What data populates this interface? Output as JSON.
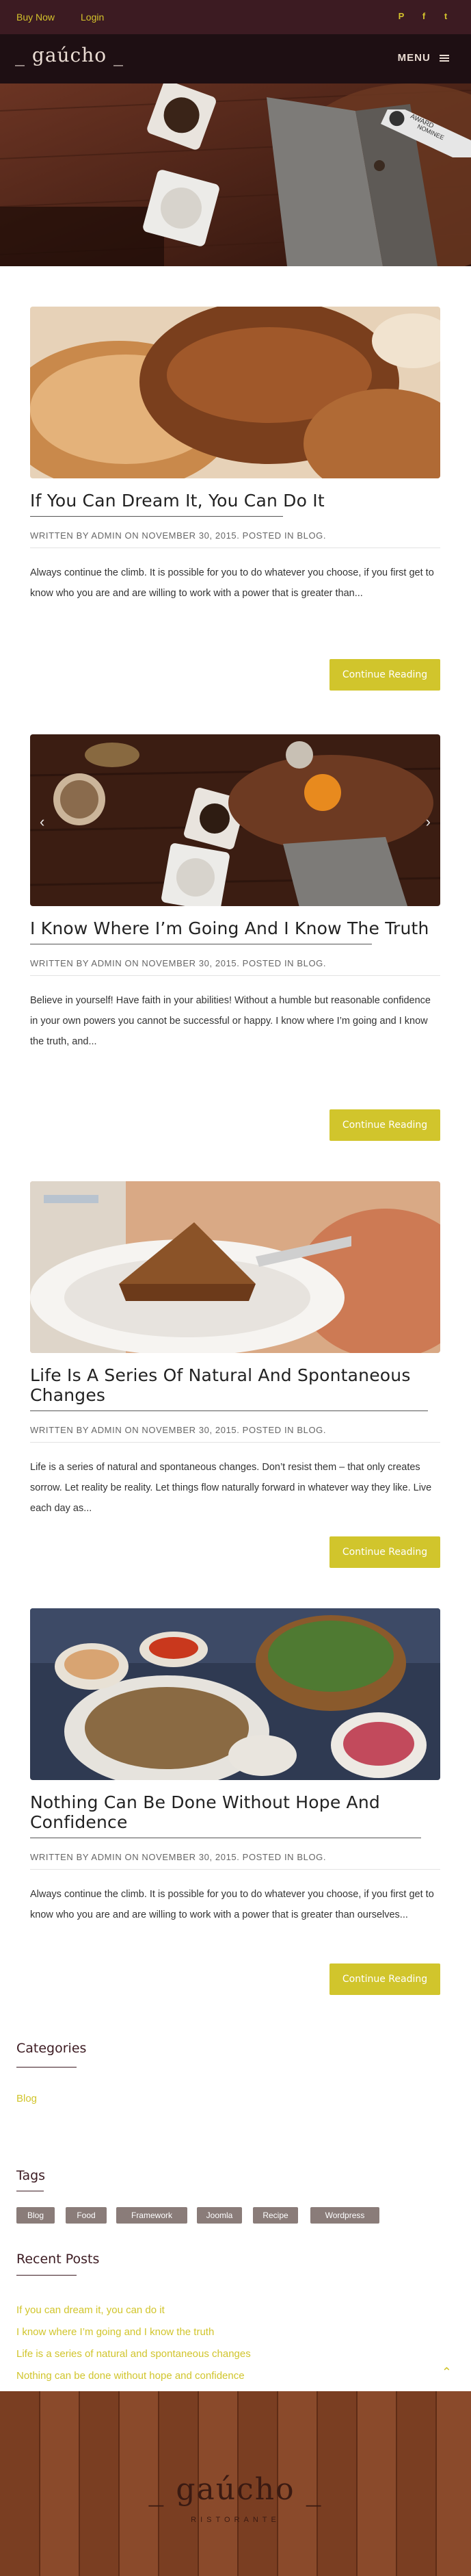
{
  "topbar": {
    "buy_now": "Buy Now",
    "login": "Login",
    "social": [
      {
        "icon": "pinterest-icon",
        "glyph": "P"
      },
      {
        "icon": "facebook-icon",
        "glyph": "f"
      },
      {
        "icon": "twitter-icon",
        "glyph": "t"
      }
    ]
  },
  "header": {
    "logo": "_ gaúcho _",
    "menu_label": "MENU"
  },
  "hero": {
    "badge_line1": "AWARD",
    "badge_line2": "NOMINEE"
  },
  "posts": [
    {
      "title": "If You Can Dream It, You Can Do It",
      "meta": "Written by admin on November 30, 2015. Posted in Blog.",
      "excerpt": "Always continue the climb. It is possible for you to do whatever you choose, if you first get to know who you are and are willing to work with a power that is greater than...",
      "button": "Continue Reading"
    },
    {
      "title": "I Know Where I’m Going And I Know The Truth",
      "meta": "Written by admin on November 30, 2015. Posted in Blog.",
      "excerpt": "Believe in yourself! Have faith in your abilities! Without a humble but reasonable confidence in your own powers you cannot be successful or happy. I know where I’m going and I know the truth, and...",
      "button": "Continue Reading"
    },
    {
      "title": "Life Is A Series Of Natural And Spontaneous Changes",
      "meta": "Written by admin on November 30, 2015. Posted in Blog.",
      "excerpt": "Life is a series of natural and spontaneous changes. Don’t resist them – that only creates sorrow. Let reality be reality. Let things flow naturally forward in whatever way they like. Live each day as...",
      "button": "Continue Reading"
    },
    {
      "title": "Nothing Can Be Done Without Hope And Confidence",
      "meta": "Written by admin on November 30, 2015. Posted in Blog.",
      "excerpt": "Always continue the climb. It is possible for you to do whatever you choose, if you first get to know who you are and are willing to work with a power that is greater than ourselves...",
      "button": "Continue Reading"
    }
  ],
  "sidebar": {
    "categories_title": "Categories",
    "categories": [
      "Blog"
    ],
    "tags_title": "Tags",
    "tags": [
      "Blog",
      "Food",
      "Framework",
      "Joomla",
      "Recipe",
      "Wordpress"
    ],
    "recent_title": "Recent Posts",
    "recent": [
      "If you can dream it, you can do it",
      "I know where I’m going and I know the truth",
      "Life is a series of natural and spontaneous changes",
      "Nothing can be done without hope and confidence"
    ]
  },
  "footer": {
    "logo": "_ gaúcho _",
    "sub": "RISTORANTE"
  },
  "colors": {
    "accent": "#d1c52c",
    "topbar": "#3c1b22",
    "header": "#1e0f13",
    "footer": "#8a4a2b"
  }
}
